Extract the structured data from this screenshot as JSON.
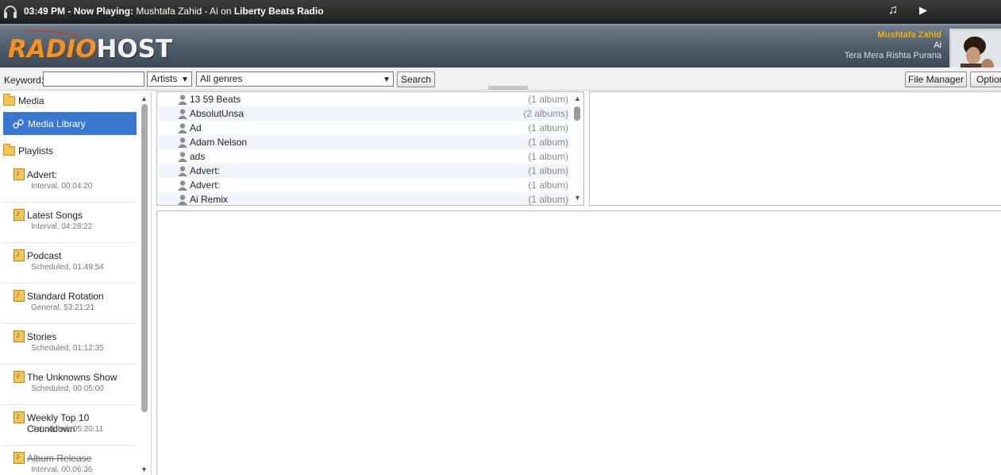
{
  "topbar": {
    "time": "03:49 PM",
    "now_playing_label": "Now Playing:",
    "song": "Mushtafa Zahid - Ai",
    "on_label": "on",
    "station": "Liberty Beats Radio"
  },
  "header": {
    "logo_radio": "RADIO",
    "logo_host": "HOST",
    "current_artist": "Mushtafa Zahid",
    "current_title": "Ai",
    "current_album": "Tera Mera Rishta Purana"
  },
  "toolbar": {
    "keyword_label": "Keyword:",
    "keyword_value": "",
    "type_select": "Artists",
    "genre_select": "All genres",
    "search_label": "Search",
    "file_manager_label": "File Manager",
    "options_label": "Option"
  },
  "sidebar": {
    "media_label": "Media",
    "media_library_label": "Media Library",
    "playlists_label": "Playlists",
    "playlists": [
      {
        "name": "Advert:",
        "meta": "Interval, 00:04:20"
      },
      {
        "name": "Latest Songs",
        "meta": "Interval, 04:28:22"
      },
      {
        "name": "Podcast",
        "meta": "Scheduled, 01:49:54"
      },
      {
        "name": "Standard Rotation",
        "meta": "General, 53:21:21"
      },
      {
        "name": "Stories",
        "meta": "Scheduled, 01:12:35"
      },
      {
        "name": "The Unknowns Show",
        "meta": "Scheduled, 00:05:00"
      },
      {
        "name": "Weekly Top 10 Countdown",
        "meta": "Scheduled, 05:20:11"
      },
      {
        "name": "Album Release",
        "meta": "Interval, 00:06:36",
        "disabled": true
      }
    ]
  },
  "artists": [
    {
      "name": "13 59 Beats",
      "count": "(1 album)"
    },
    {
      "name": "AbsolutUnsa",
      "count": "(2 albums)"
    },
    {
      "name": "Ad",
      "count": "(1 album)"
    },
    {
      "name": "Adam Nelson",
      "count": "(1 album)"
    },
    {
      "name": "ads",
      "count": "(1 album)"
    },
    {
      "name": "Advert:",
      "count": "(1 album)"
    },
    {
      "name": "Advert:",
      "count": "(1 album)"
    },
    {
      "name": "Ai Remix",
      "count": "(1 album)"
    }
  ],
  "colors": {
    "accent_blue": "#3a78d0",
    "logo_orange": "#f0932a",
    "artist_gold": "#f4b400"
  }
}
